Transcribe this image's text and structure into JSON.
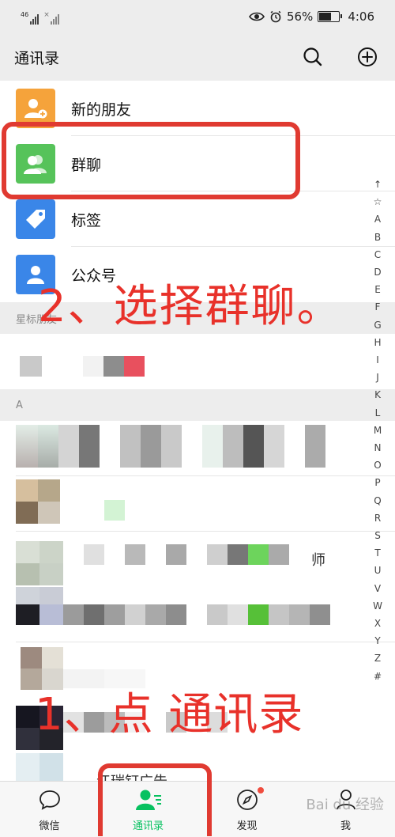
{
  "status": {
    "network": "46",
    "battery": "56%",
    "time": "4:06"
  },
  "header": {
    "title": "通讯录"
  },
  "fixed_items": [
    {
      "label": "新的朋友",
      "icon": "add-friend-icon",
      "color": "#f5a33b"
    },
    {
      "label": "群聊",
      "icon": "group-chat-icon",
      "color": "#56c35a"
    },
    {
      "label": "标签",
      "icon": "tag-icon",
      "color": "#3a86e8"
    },
    {
      "label": "公众号",
      "icon": "official-account-icon",
      "color": "#3a86e8"
    }
  ],
  "sections": {
    "starred": "星标朋友",
    "a": "A"
  },
  "contacts": {
    "row6_suffix": "师",
    "row9_text": "…江瑞钉广告"
  },
  "alphabet": [
    "↑",
    "☆",
    "A",
    "B",
    "C",
    "D",
    "E",
    "F",
    "G",
    "H",
    "I",
    "J",
    "K",
    "L",
    "M",
    "N",
    "O",
    "P",
    "Q",
    "R",
    "S",
    "T",
    "U",
    "V",
    "W",
    "X",
    "Y",
    "Z",
    "#"
  ],
  "annotations": {
    "step2": "2、选择群聊。",
    "step1": "1、点 通讯录"
  },
  "tabs": [
    {
      "label": "微信",
      "icon": "chat-icon"
    },
    {
      "label": "通讯录",
      "icon": "contacts-icon",
      "active": true
    },
    {
      "label": "发现",
      "icon": "compass-icon"
    },
    {
      "label": "我",
      "icon": "person-icon"
    }
  ],
  "watermark": "Bai du 经验",
  "colors": {
    "accent": "#07c160",
    "annotation": "#e03a31"
  }
}
